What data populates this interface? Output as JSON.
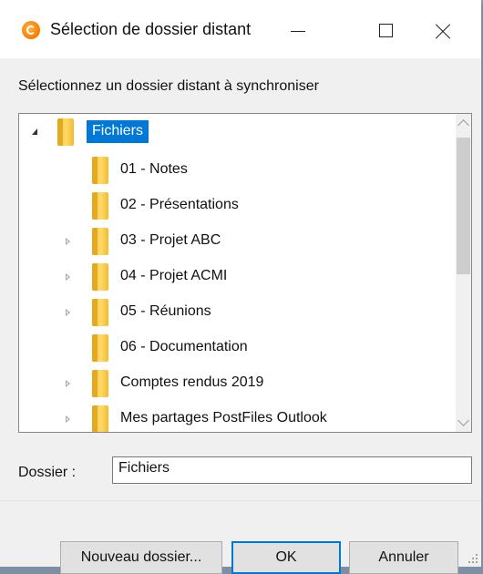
{
  "window": {
    "title": "Sélection de dossier distant"
  },
  "instruction": "Sélectionnez un dossier distant à synchroniser",
  "tree": {
    "nodes": [
      {
        "label": "Fichiers",
        "expander": "expanded",
        "selected": true
      },
      {
        "label": "01 - Notes",
        "expander": "none"
      },
      {
        "label": "02 - Présentations",
        "expander": "none"
      },
      {
        "label": "03 - Projet ABC",
        "expander": "collapsed"
      },
      {
        "label": "04 - Projet ACMI",
        "expander": "collapsed"
      },
      {
        "label": "05 - Réunions",
        "expander": "collapsed"
      },
      {
        "label": "06 - Documentation",
        "expander": "none"
      },
      {
        "label": "Comptes rendus 2019",
        "expander": "collapsed"
      },
      {
        "label": "Mes partages PostFiles Outlook",
        "expander": "collapsed"
      }
    ]
  },
  "folder": {
    "label": "Dossier :",
    "value": "Fichiers"
  },
  "buttons": {
    "new_folder": "Nouveau dossier...",
    "ok": "OK",
    "cancel": "Annuler"
  },
  "colors": {
    "selection": "#0078d7",
    "folder": "#ffd966",
    "dialog_bg": "#f0f0f0"
  }
}
